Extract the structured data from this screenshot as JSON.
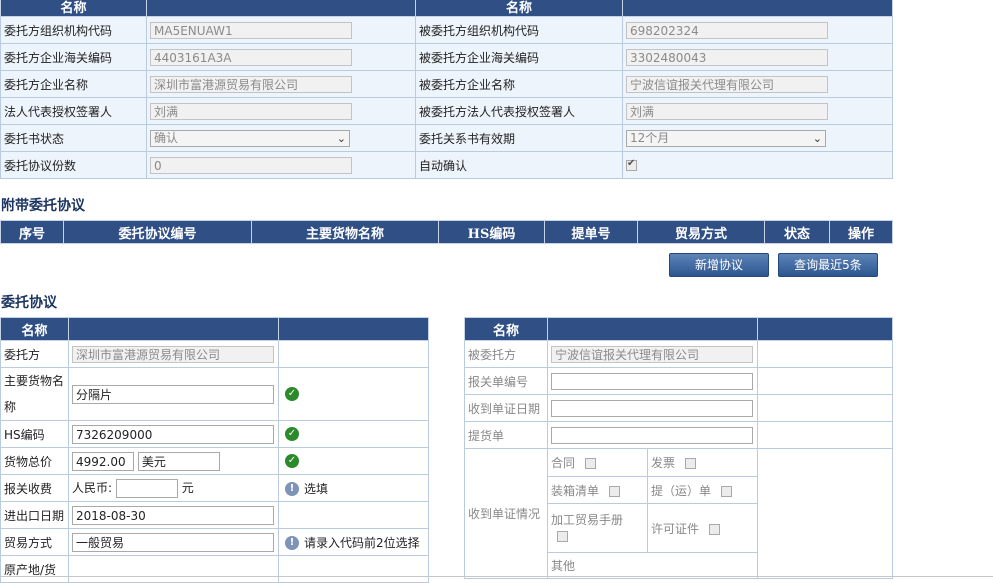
{
  "basic": {
    "header_name": "名称",
    "rows": [
      {
        "l1": "委托方组织机构代码",
        "v1": "MA5ENUAW1",
        "l2": "被委托方组织机构代码",
        "v2": "698202324"
      },
      {
        "l1": "委托方企业海关编码",
        "v1": "4403161A3A",
        "l2": "被委托方企业海关编码",
        "v2": "3302480043"
      },
      {
        "l1": "委托方企业名称",
        "v1": "深圳市富港源贸易有限公司",
        "l2": "被委托方企业名称",
        "v2": "宁波信谊报关代理有限公司"
      },
      {
        "l1": "法人代表授权签署人",
        "v1": "刘满",
        "l2": "被委托方法人代表授权签署人",
        "v2": "刘满"
      }
    ],
    "status_label": "委托书状态",
    "status_value": "确认",
    "validity_label": "委托关系书有效期",
    "validity_value": "12个月",
    "copies_label": "委托协议份数",
    "copies_value": "0",
    "auto_confirm_label": "自动确认"
  },
  "attached": {
    "title": "附带委托协议",
    "columns": [
      "序号",
      "委托协议编号",
      "主要货物名称",
      "HS编码",
      "提单号",
      "贸易方式",
      "状态",
      "操作"
    ],
    "add_button": "新增协议",
    "query_button": "查询最近5条"
  },
  "agreement": {
    "title": "委托协议",
    "header_name": "名称",
    "client_label": "委托方",
    "client_value": "深圳市富港源贸易有限公司",
    "goods_label": "主要货物名称",
    "goods_value": "分隔片",
    "hs_label": "HS编码",
    "hs_value": "7326209000",
    "total_label": "货物总价",
    "total_value": "4992.00",
    "currency_value": "美元",
    "fee_label": "报关收费",
    "fee_prefix": "人民币:",
    "fee_value": "",
    "fee_unit": "元",
    "fee_hint": "选填",
    "date_label": "进出口日期",
    "date_value": "2018-08-30",
    "trade_label": "贸易方式",
    "trade_value": "一般贸易",
    "trade_hint": "请录入代码前2位选择",
    "origin_label": "原产地/货"
  },
  "agent": {
    "header_name": "名称",
    "agent_label": "被委托方",
    "agent_value": "宁波信谊报关代理有限公司",
    "decl_label": "报关单编号",
    "receipt_date_label": "收到单证日期",
    "bill_label": "提货单",
    "docs_label": "收到单证情况",
    "doc_contract": "合同",
    "doc_invoice": "发票",
    "doc_packing": "装箱清单",
    "doc_bol": "提（运）单",
    "doc_manual": "加工贸易手册",
    "doc_license": "许可证件",
    "doc_other": "其他"
  },
  "colors": {
    "header_bg": "#2f4f85",
    "row_bg": "#eef4fb",
    "ok": "#2c8a2c"
  }
}
